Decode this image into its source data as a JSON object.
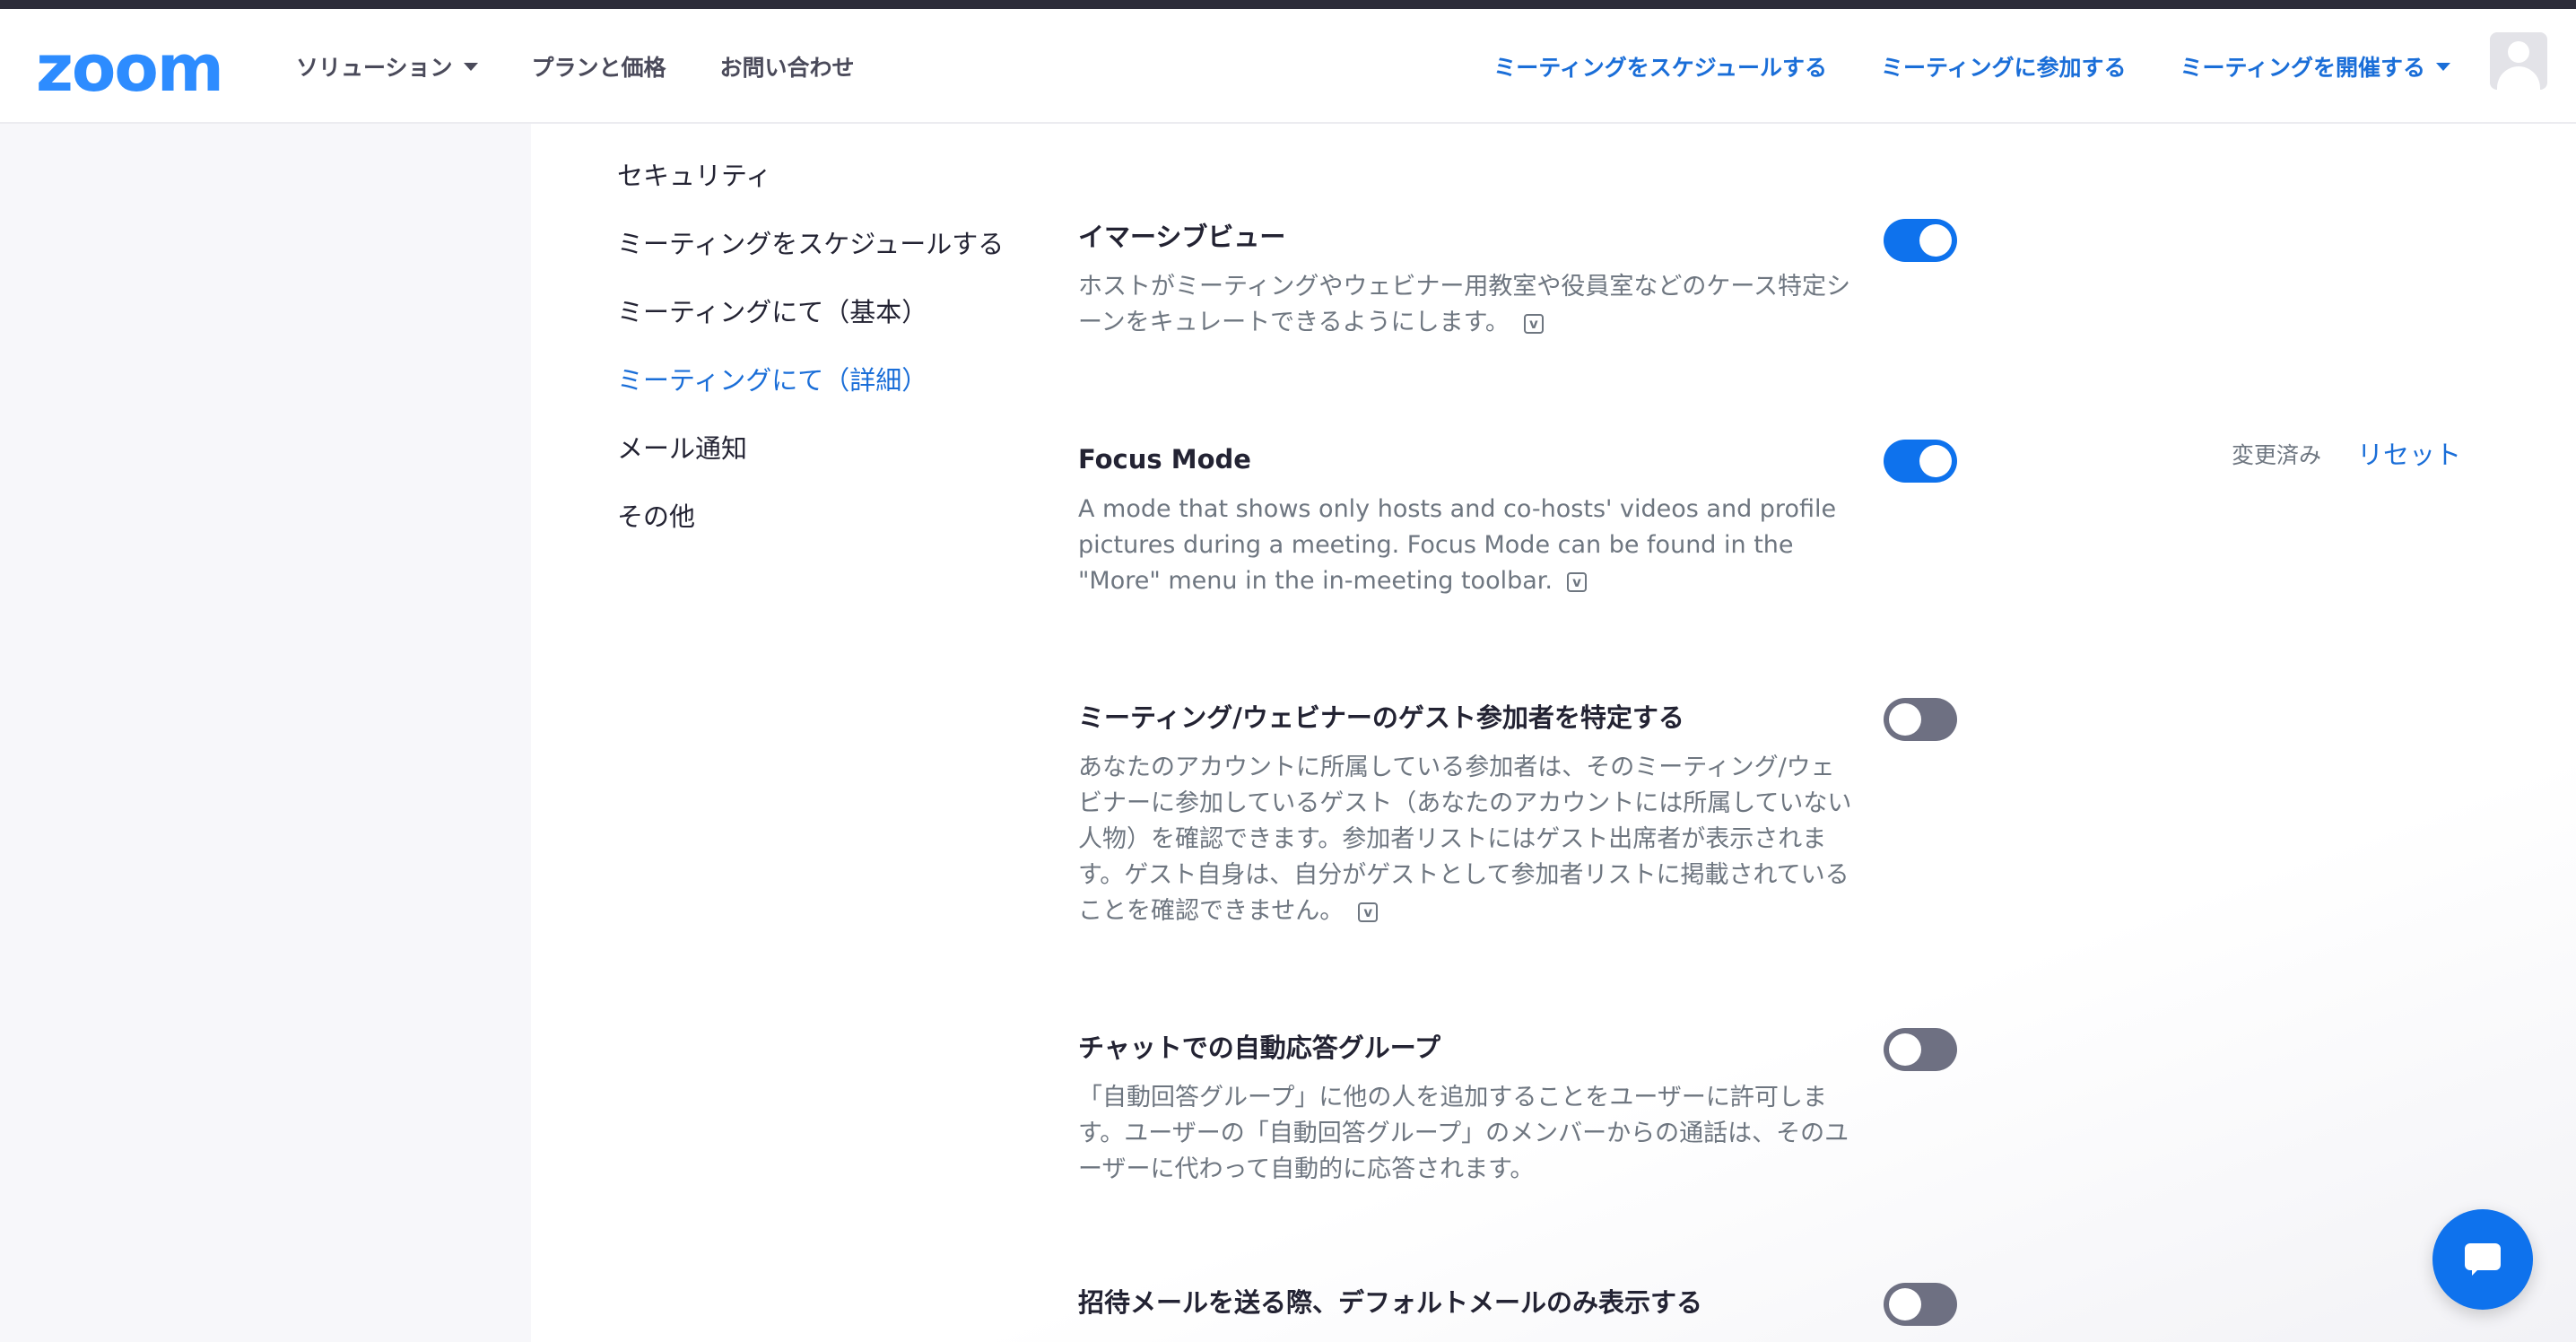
{
  "header": {
    "logo": "zoom",
    "nav_left": [
      {
        "label": "ソリューション",
        "has_dropdown": true
      },
      {
        "label": "プランと価格",
        "has_dropdown": false
      },
      {
        "label": "お問い合わせ",
        "has_dropdown": false
      }
    ],
    "nav_right": [
      {
        "label": "ミーティングをスケジュールする",
        "has_dropdown": false
      },
      {
        "label": "ミーティングに参加する",
        "has_dropdown": false
      },
      {
        "label": "ミーティングを開催する",
        "has_dropdown": true
      }
    ]
  },
  "sidebar": {
    "items": [
      {
        "label": "セキュリティ",
        "active": false
      },
      {
        "label": "ミーティングをスケジュールする",
        "active": false
      },
      {
        "label": "ミーティングにて（基本）",
        "active": false
      },
      {
        "label": "ミーティングにて（詳細）",
        "active": true
      },
      {
        "label": "メール通知",
        "active": false
      },
      {
        "label": "その他",
        "active": false
      }
    ]
  },
  "settings": [
    {
      "title": "イマーシブビュー",
      "description": "ホストがミーティングやウェビナー用教室や役員室などのケース特定シーンをキュレートできるようにします。",
      "enabled": true,
      "has_info_icon": true
    },
    {
      "title": "Focus Mode",
      "description": "A mode that shows only hosts and co-hosts' videos and profile pictures during a meeting. Focus Mode can be found in the \"More\" menu in the in-meeting toolbar.",
      "enabled": true,
      "has_info_icon": true,
      "modified_label": "変更済み",
      "reset_label": "リセット"
    },
    {
      "title": "ミーティング/ウェビナーのゲスト参加者を特定する",
      "description": "あなたのアカウントに所属している参加者は、そのミーティング/ウェビナーに参加しているゲスト（あなたのアカウントには所属していない人物）を確認できます。参加者リストにはゲスト出席者が表示されます。ゲスト自身は、自分がゲストとして参加者リストに掲載されていることを確認できません。",
      "enabled": false,
      "has_info_icon": true
    },
    {
      "title": "チャットでの自動応答グループ",
      "description": "「自動回答グループ」に他の人を追加することをユーザーに許可します。ユーザーの「自動回答グループ」のメンバーからの通話は、そのユーザーに代わって自動的に応答されます。",
      "enabled": false,
      "has_info_icon": false
    },
    {
      "title": "招待メールを送る際、デフォルトメールのみ表示する",
      "description": "",
      "enabled": false,
      "has_info_icon": false
    }
  ],
  "colors": {
    "brand_blue": "#2d8cff",
    "link_blue": "#1a6ed8",
    "toggle_on": "#0e72ed",
    "toggle_off": "#6e7082"
  }
}
